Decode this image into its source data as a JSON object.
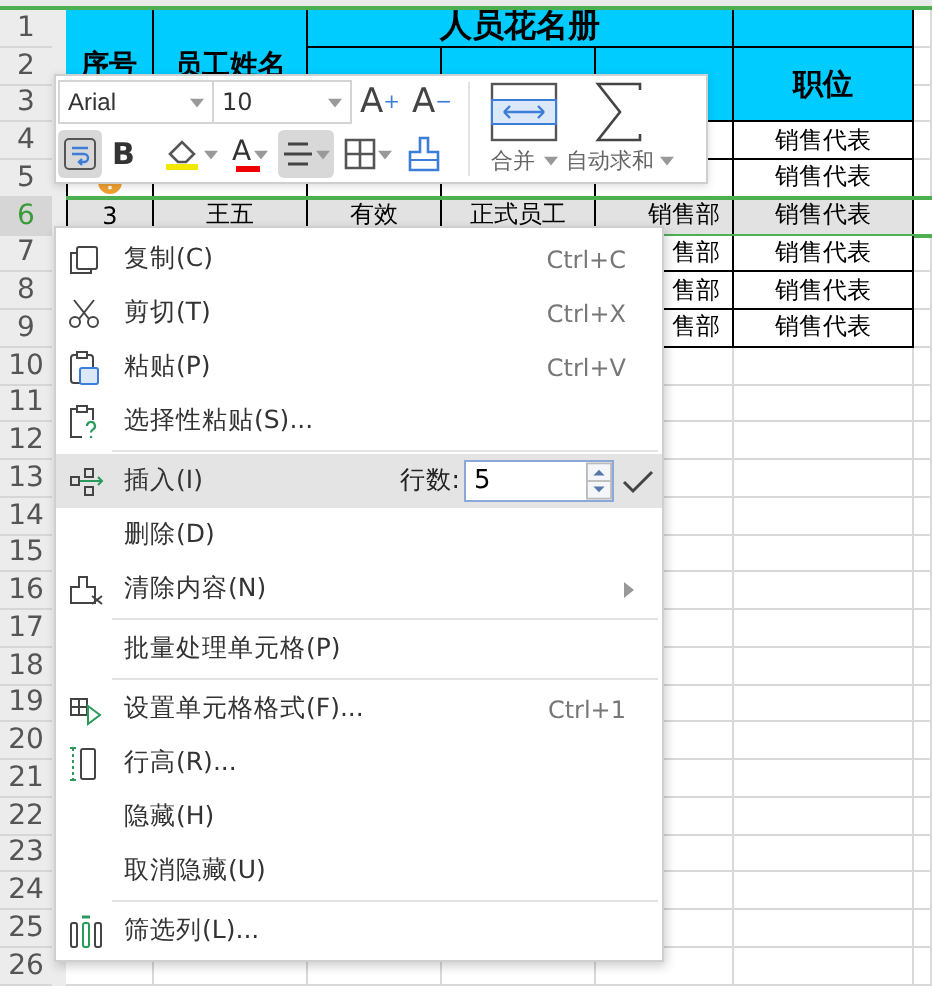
{
  "sheet": {
    "row_numbers": [
      {
        "label": "1",
        "selected": false
      },
      {
        "label": "2",
        "selected": false
      },
      {
        "label": "3",
        "selected": false
      },
      {
        "label": "4",
        "selected": false
      },
      {
        "label": "5",
        "selected": false
      },
      {
        "label": "6",
        "selected": true
      },
      {
        "label": "7",
        "selected": false
      },
      {
        "label": "8",
        "selected": false
      },
      {
        "label": "9",
        "selected": false
      },
      {
        "label": "10",
        "selected": false
      },
      {
        "label": "11",
        "selected": false
      },
      {
        "label": "12",
        "selected": false
      },
      {
        "label": "13",
        "selected": false
      },
      {
        "label": "14",
        "selected": false
      },
      {
        "label": "15",
        "selected": false
      },
      {
        "label": "16",
        "selected": false
      },
      {
        "label": "17",
        "selected": false
      },
      {
        "label": "18",
        "selected": false
      },
      {
        "label": "19",
        "selected": false
      },
      {
        "label": "20",
        "selected": false
      },
      {
        "label": "21",
        "selected": false
      },
      {
        "label": "22",
        "selected": false
      },
      {
        "label": "23",
        "selected": false
      },
      {
        "label": "24",
        "selected": false
      },
      {
        "label": "25",
        "selected": false
      },
      {
        "label": "26",
        "selected": false
      }
    ],
    "title": "人员花名册",
    "header_cells": [
      "序号",
      "员工姓名",
      "职位"
    ],
    "data_rows": [
      {
        "cells": {
          "F": "销售代表"
        }
      },
      {
        "error_marker": true,
        "cells": {
          "F": "销售代表"
        }
      },
      {
        "cells": {
          "A": "3",
          "B": "王五",
          "C": "有效",
          "D": "正式员工",
          "E": "销售部",
          "F": "销售代表"
        }
      },
      {
        "cells": {
          "E": "售部",
          "F": "销售代表"
        }
      },
      {
        "cells": {
          "E": "售部",
          "F": "销售代表"
        }
      },
      {
        "cells": {
          "E": "售部",
          "F": "销售代表"
        }
      }
    ]
  },
  "toolbar": {
    "font_field": "Arial",
    "size_field": "10",
    "size_buttons": [
      "A$^{+}$",
      "A$^{−}$"
    ],
    "format_buttons": [
      {
        "kind": "wrap",
        "selected": true,
        "dropdown": false
      },
      {
        "kind": "bold",
        "label": "B",
        "selected": false,
        "dropdown": false
      },
      {
        "kind": "fill",
        "selected": false,
        "dropdown": true
      },
      {
        "kind": "font_color",
        "label": "A",
        "selected": false,
        "dropdown": true
      },
      {
        "kind": "align",
        "selected": true,
        "dropdown": true
      },
      {
        "kind": "border",
        "selected": false,
        "dropdown": true
      },
      {
        "kind": "painter",
        "selected": false,
        "dropdown": false
      }
    ],
    "big_buttons": [
      {
        "kind": "merge",
        "label": "合并",
        "dropdown": true
      },
      {
        "kind": "sum",
        "label": "自动求和",
        "dropdown": true
      }
    ]
  },
  "context_menu": {
    "groups": [
      [
        {
          "label": "复制(C)",
          "shortcut": "Ctrl+C",
          "selected": false,
          "has_submenu": false
        },
        {
          "label": "剪切(T)",
          "shortcut": "Ctrl+X",
          "selected": false,
          "has_submenu": false
        },
        {
          "label": "粘贴(P)",
          "shortcut": "Ctrl+V",
          "selected": false,
          "has_submenu": false
        },
        {
          "label": "选择性粘贴(S)...",
          "selected": false,
          "has_submenu": false
        }
      ],
      [
        {
          "label": "插入(I)",
          "selected": true,
          "has_submenu": false,
          "count_field": {
            "label": "行数:",
            "value": "5"
          }
        },
        {
          "label": "删除(D)",
          "selected": false,
          "has_submenu": false
        },
        {
          "label": "清除内容(N)",
          "selected": false,
          "has_submenu": true
        }
      ],
      [
        {
          "label": "批量处理单元格(P)",
          "selected": false,
          "has_submenu": false
        }
      ],
      [
        {
          "label": "设置单元格格式(F)...",
          "shortcut": "Ctrl+1",
          "selected": false,
          "has_submenu": false
        },
        {
          "label": "行高(R)...",
          "selected": false,
          "has_submenu": false
        },
        {
          "label": "隐藏(H)",
          "selected": false,
          "has_submenu": false
        },
        {
          "label": "取消隐藏(U)",
          "selected": false,
          "has_submenu": false
        }
      ],
      [
        {
          "label": "筛选列(L)...",
          "selected": false,
          "has_submenu": false
        }
      ]
    ]
  }
}
